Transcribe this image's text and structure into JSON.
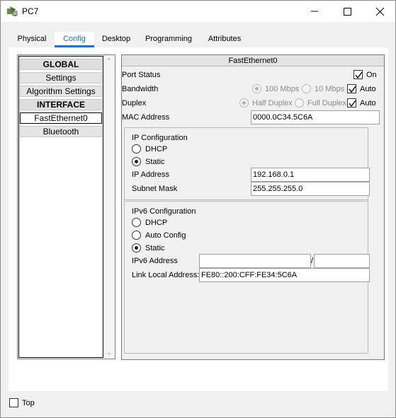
{
  "window": {
    "title": "PC7",
    "icon": "packet-tracer-pc-icon"
  },
  "tabs": [
    {
      "label": "Physical"
    },
    {
      "label": "Config"
    },
    {
      "label": "Desktop"
    },
    {
      "label": "Programming"
    },
    {
      "label": "Attributes"
    }
  ],
  "active_tab": "Config",
  "sidebar": {
    "items": [
      {
        "label": "GLOBAL",
        "type": "header"
      },
      {
        "label": "Settings",
        "type": "item"
      },
      {
        "label": "Algorithm Settings",
        "type": "item"
      },
      {
        "label": "INTERFACE",
        "type": "header"
      },
      {
        "label": "FastEthernet0",
        "type": "item",
        "selected": true
      },
      {
        "label": "Bluetooth",
        "type": "item"
      }
    ]
  },
  "panel": {
    "title": "FastEthernet0",
    "port_status": {
      "label": "Port Status",
      "on_label": "On",
      "on_checked": true
    },
    "bandwidth": {
      "label": "Bandwidth",
      "opt_100": "100 Mbps",
      "opt_10": "10 Mbps",
      "auto_label": "Auto",
      "auto_checked": true
    },
    "duplex": {
      "label": "Duplex",
      "half": "Half Duplex",
      "full": "Full Duplex",
      "auto_label": "Auto",
      "auto_checked": true
    },
    "mac": {
      "label": "MAC Address",
      "value": "0000.0C34.5C6A"
    },
    "ipv4": {
      "title": "IP Configuration",
      "dhcp": "DHCP",
      "static": "Static",
      "selected": "Static",
      "ip_label": "IP Address",
      "ip_value": "192.168.0.1",
      "mask_label": "Subnet Mask",
      "mask_value": "255.255.255.0"
    },
    "ipv6": {
      "title": "IPv6 Configuration",
      "dhcp": "DHCP",
      "auto": "Auto Config",
      "static": "Static",
      "selected": "Static",
      "addr_label": "IPv6 Address",
      "addr_value": "",
      "prefix_value": "",
      "slash": "/",
      "link_local_label": "Link Local Address:",
      "link_local_value": "FE80::200:CFF:FE34:5C6A"
    }
  },
  "bottom": {
    "top_label": "Top",
    "top_checked": false
  },
  "colors": {
    "accent": "#1a72c9"
  }
}
